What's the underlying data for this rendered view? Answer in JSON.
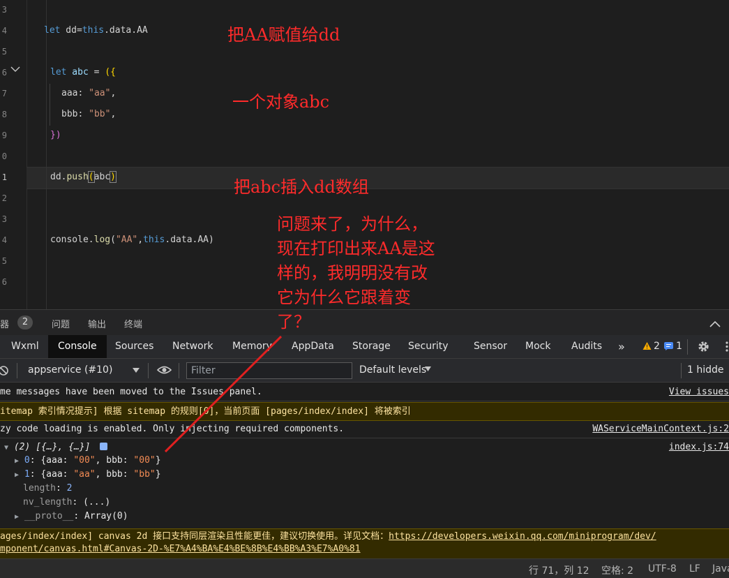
{
  "editor": {
    "line_numbers": [
      "3",
      "4",
      "5",
      "6",
      "7",
      "8",
      "9",
      "0",
      "1",
      "2",
      "3",
      "4",
      "5",
      "6"
    ],
    "code": {
      "line_let_dd": {
        "kw": "let",
        "rest_a": " dd=",
        "kw2": "this",
        "rest_b": ".data.AA"
      },
      "line_let_abc": {
        "kw": "let",
        "var": " abc",
        "rest": " = ",
        "open": "({"
      },
      "line_aaa": {
        "key": "aaa: ",
        "val": "\"aa\"",
        "comma": ","
      },
      "line_bbb": {
        "key": "bbb: ",
        "val": "\"bb\"",
        "comma": ","
      },
      "line_close": "})",
      "line_push": {
        "obj": "dd.",
        "fn": "push",
        "open": "(",
        "arg": "abc",
        "close": ")"
      },
      "line_log": {
        "obj": "console.",
        "fn": "log",
        "open": "(",
        "str": "\"AA\"",
        "comma": ",",
        "kw": "this",
        "rest": ".data.AA)"
      }
    },
    "annotations": {
      "a1": "把AA赋值给dd",
      "a2": "一个对象abc",
      "a3": "把abc插入dd数组",
      "q1": "问题来了，为什么，",
      "q2": "现在打印出来AA是这",
      "q3": "样的，我明明没有改",
      "q4": "它为什么它跟着变",
      "q5": "了？"
    }
  },
  "panel_tabs": {
    "debugger": "器",
    "badge": "2",
    "problems": "问题",
    "output": "输出",
    "terminal": "终端"
  },
  "devtools_tabs": [
    "Wxml",
    "Console",
    "Sources",
    "Network",
    "Memory",
    "AppData",
    "Storage",
    "Security",
    "Sensor",
    "Mock",
    "Audits"
  ],
  "tab_more": "»",
  "warn_count": "2",
  "info_count": "1",
  "filterbar": {
    "context": "appservice (#10)",
    "filter_placeholder": "Filter",
    "levels": "Default levels",
    "hidden": "1 hidde"
  },
  "console": {
    "msg1": "me messages have been moved to the Issues panel.",
    "msg1_link": "View issues",
    "msg2": "itemap 索引情况提示] 根据 sitemap 的规则[0]，当前页面 [pages/index/index] 将被索引",
    "msg3": "zy code loading is enabled. Only injecting required components.",
    "msg3_src": "WAServiceMainContext.js:2",
    "arr_summary": "(2) [{…}, {…}]",
    "arr_src": "index.js:74",
    "item0_idx": "0",
    "item0_aaa": "\"00\"",
    "item0_bbb": "\"00\"",
    "item1_idx": "1",
    "item1_aaa": "\"aa\"",
    "item1_bbb": "\"bb\"",
    "length_key": "length",
    "length_val": "2",
    "nv_key": "nv_length",
    "nv_val": "(...)",
    "proto_key": "__proto__",
    "proto_val": "Array(0)",
    "msg4": "ages/index/index] canvas 2d 接口支持同层渲染且性能更佳，建议切换使用。详见文档：",
    "msg4_link": "https://developers.weixin.qq.com/miniprogram/dev/",
    "msg4_link2": "mponent/canvas.html#Canvas-2D-%E7%A4%BA%E4%BE%8B%E4%BB%A3%E7%A0%81"
  },
  "statusbar": {
    "position": "行 71，列 12",
    "spaces": "空格: 2",
    "encoding": "UTF-8",
    "eol": "LF",
    "lang": "Java"
  },
  "colors": {
    "annotation": "#ff2b2b",
    "arrow": "#e02020",
    "accent_tab": "#0f0f0f"
  }
}
